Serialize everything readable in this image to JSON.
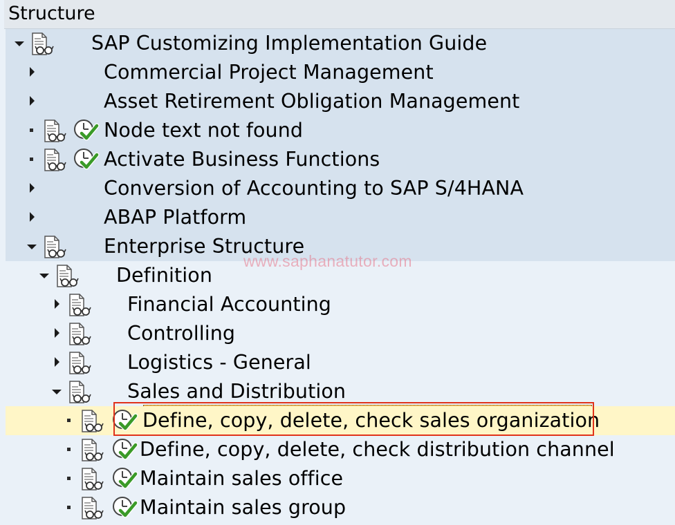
{
  "panel": {
    "header": "Structure"
  },
  "watermark": "www.saphanatutor.com",
  "tree": [
    {
      "label": "SAP Customizing Implementation Guide",
      "expander": "expanded",
      "doc_icon": true,
      "clock_icon": false
    },
    {
      "label": "Commercial Project Management",
      "expander": "collapsed",
      "doc_icon": false,
      "clock_icon": false
    },
    {
      "label": "Asset Retirement Obligation Management",
      "expander": "collapsed",
      "doc_icon": false,
      "clock_icon": false
    },
    {
      "label": "Node text not found",
      "expander": "leaf",
      "doc_icon": true,
      "clock_icon": true
    },
    {
      "label": "Activate Business Functions",
      "expander": "leaf",
      "doc_icon": true,
      "clock_icon": true
    },
    {
      "label": "Conversion of Accounting to SAP S/4HANA",
      "expander": "collapsed",
      "doc_icon": false,
      "clock_icon": false
    },
    {
      "label": "ABAP Platform",
      "expander": "collapsed",
      "doc_icon": false,
      "clock_icon": false
    },
    {
      "label": "Enterprise Structure",
      "expander": "expanded",
      "doc_icon": true,
      "clock_icon": false
    },
    {
      "label": "Definition",
      "expander": "expanded",
      "doc_icon": true,
      "clock_icon": false
    },
    {
      "label": "Financial Accounting",
      "expander": "collapsed",
      "doc_icon": true,
      "clock_icon": false
    },
    {
      "label": "Controlling",
      "expander": "collapsed",
      "doc_icon": true,
      "clock_icon": false
    },
    {
      "label": "Logistics - General",
      "expander": "collapsed",
      "doc_icon": true,
      "clock_icon": false
    },
    {
      "label": "Sales and Distribution",
      "expander": "expanded",
      "doc_icon": true,
      "clock_icon": false
    },
    {
      "label": "Define, copy, delete, check sales organization",
      "expander": "leaf",
      "doc_icon": true,
      "clock_icon": true,
      "selected": true
    },
    {
      "label": "Define, copy, delete, check distribution channel",
      "expander": "leaf",
      "doc_icon": true,
      "clock_icon": true
    },
    {
      "label": "Maintain sales office",
      "expander": "leaf",
      "doc_icon": true,
      "clock_icon": true
    },
    {
      "label": "Maintain sales group",
      "expander": "leaf",
      "doc_icon": true,
      "clock_icon": true
    }
  ],
  "colors": {
    "band_dark": "#d6e2ee",
    "band_light": "#eaf1f8",
    "selection_fill": "#f9c76b",
    "selection_border": "#e0321a",
    "check_green": "#3a9a28"
  }
}
